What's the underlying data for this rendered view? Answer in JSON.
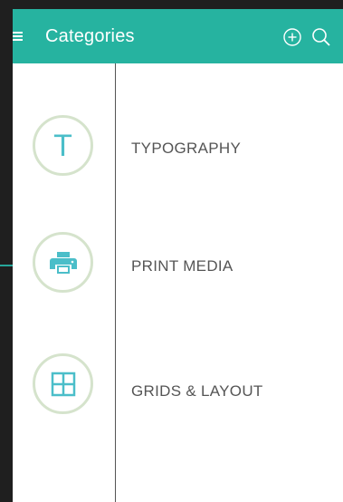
{
  "appbar": {
    "title": "Categories",
    "background": "#26b3a0"
  },
  "categories": [
    {
      "label": "TYPOGRAPHY",
      "icon": "typography-icon",
      "glyph": "T"
    },
    {
      "label": "PRINT MEDIA",
      "icon": "printer-icon"
    },
    {
      "label": "GRIDS & LAYOUT",
      "icon": "grid-icon"
    }
  ],
  "colors": {
    "accent": "#4bbec9",
    "circle_border": "#d5e3cc",
    "label": "#555555"
  }
}
